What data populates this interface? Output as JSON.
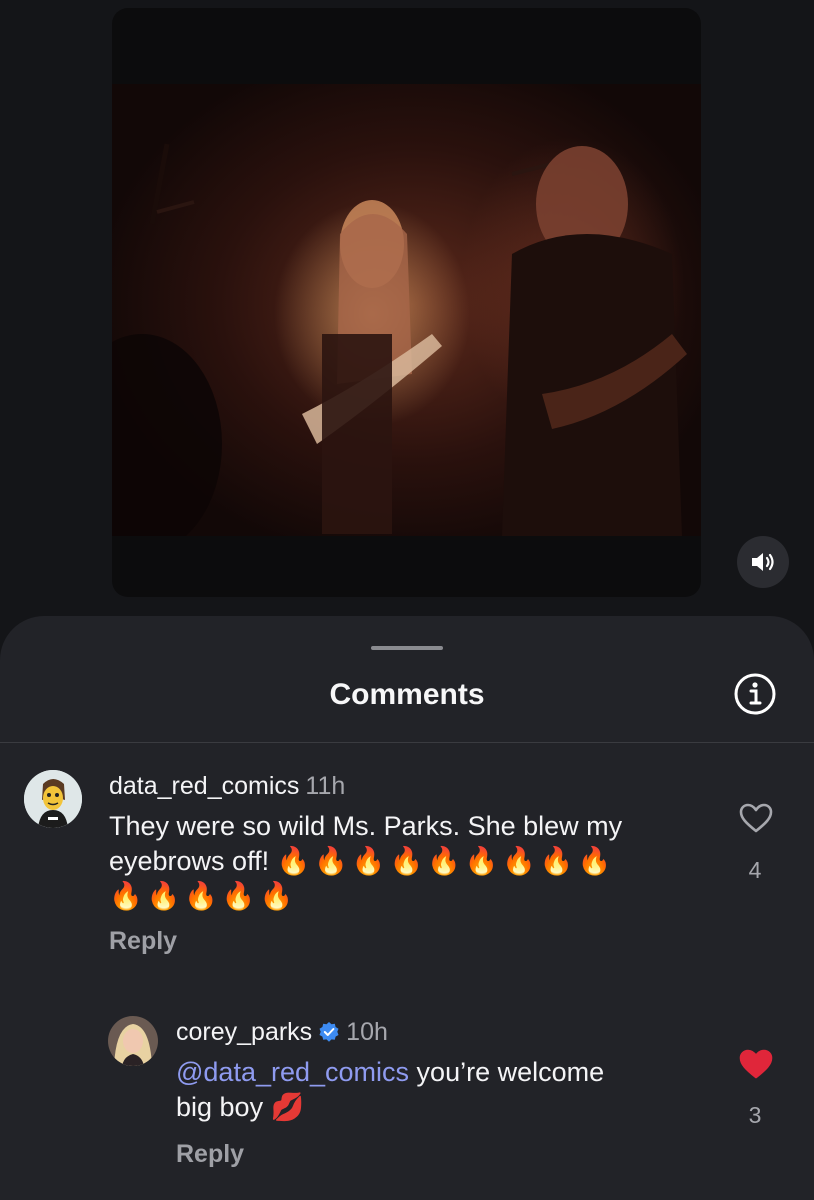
{
  "sheet": {
    "title": "Comments"
  },
  "comments": [
    {
      "username": "data_red_comics",
      "time": "11h",
      "text": "They were so wild Ms. Parks. She blew my eyebrows off!",
      "emoji_line1": "🔥🔥🔥🔥🔥🔥🔥🔥🔥",
      "emoji_line2": "🔥🔥🔥🔥🔥",
      "reply_label": "Reply",
      "likes": "4",
      "liked": false
    },
    {
      "username": "corey_parks",
      "verified": true,
      "time": "10h",
      "mention": "@data_red_comics",
      "text": "you’re welcome",
      "text_line2": "big boy",
      "emoji": "💋",
      "reply_label": "Reply",
      "likes": "3",
      "liked": true
    }
  ],
  "colors": {
    "background": "#141518",
    "sheet": "#222328",
    "mention": "#8f9bf0",
    "liked_heart": "#e0263a",
    "verified_badge": "#3d8bf2"
  },
  "icons": {
    "mute": "speaker-icon",
    "info": "info-icon",
    "like": "heart-icon"
  }
}
